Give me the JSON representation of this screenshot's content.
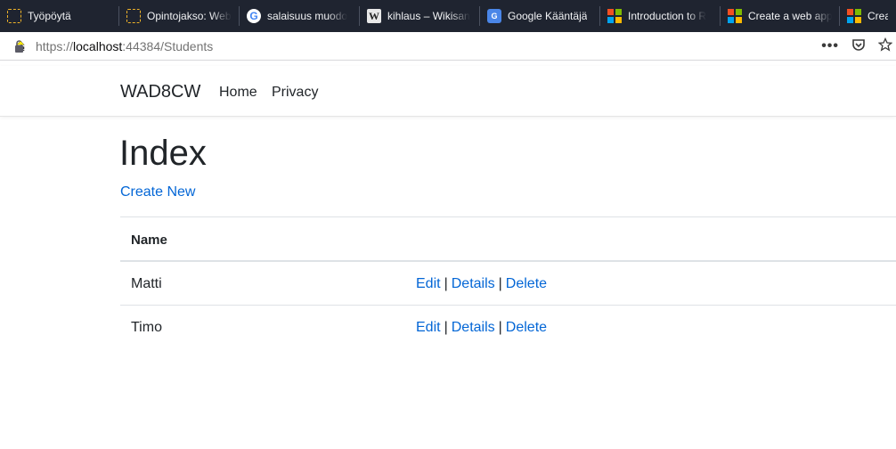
{
  "browser": {
    "bookmarks": [
      {
        "label": "Työpöytä",
        "icon": "folder-dashed-icon"
      },
      {
        "label": "Opintojakso: Web",
        "icon": "folder-dashed-icon"
      },
      {
        "label": "salaisuus muodo",
        "icon": "google-icon"
      },
      {
        "label": "kihlaus – Wikisan",
        "icon": "wiktionary-icon"
      },
      {
        "label": "Google Kääntäjä",
        "icon": "google-translate-icon"
      },
      {
        "label": "Introduction to R",
        "icon": "microsoft-icon"
      },
      {
        "label": "Create a web app",
        "icon": "microsoft-icon"
      },
      {
        "label": "Create",
        "icon": "microsoft-icon"
      }
    ],
    "url": {
      "scheme": "https://",
      "host": "localhost",
      "rest": ":44384/Students"
    }
  },
  "site": {
    "brand": "WAD8CW",
    "nav": {
      "home": "Home",
      "privacy": "Privacy"
    }
  },
  "page": {
    "title": "Index",
    "create_new": "Create New",
    "table": {
      "header": {
        "name": "Name"
      },
      "rows": [
        {
          "name": "Matti",
          "edit": "Edit",
          "details": "Details",
          "delete": "Delete"
        },
        {
          "name": "Timo",
          "edit": "Edit",
          "details": "Details",
          "delete": "Delete"
        }
      ]
    }
  },
  "colors": {
    "bookmarks_bg": "#1f2430",
    "link": "#0366d6",
    "text": "#212529"
  }
}
